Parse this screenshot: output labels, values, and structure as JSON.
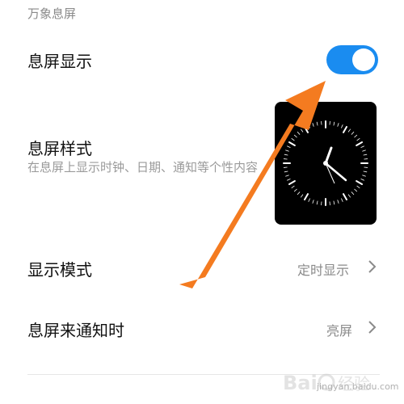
{
  "section": {
    "title": "万象息屏"
  },
  "aod": {
    "label": "息屏显示",
    "enabled": true
  },
  "style": {
    "label": "息屏样式",
    "description": "在息屏上显示时钟、日期、通知等个性内容"
  },
  "display_mode": {
    "label": "显示模式",
    "value": "定时显示"
  },
  "notification": {
    "label": "息屏来通知时",
    "value": "亮屏"
  },
  "watermark": {
    "text": "jingyan.baidu.com"
  },
  "colors": {
    "accent": "#1a8cf0",
    "arrow": "#f47b20"
  }
}
